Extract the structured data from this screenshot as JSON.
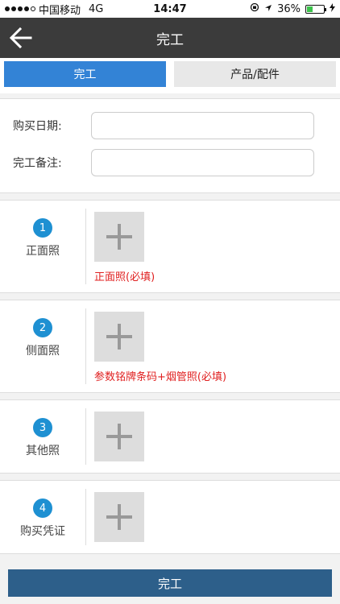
{
  "statusbar": {
    "carrier": "中国移动",
    "network": "4G",
    "time": "14:47",
    "battery_text": "36%",
    "battery_level": 0.36,
    "battery_color": "#3cc34b"
  },
  "navbar": {
    "title": "完工",
    "back_icon": "arrow-left-icon"
  },
  "tabs": [
    {
      "label": "完工",
      "active": true
    },
    {
      "label": "产品/配件",
      "active": false
    }
  ],
  "form": {
    "purchase_date_label": "购买日期:",
    "purchase_date_value": "",
    "note_label": "完工备注:",
    "note_value": ""
  },
  "photos": [
    {
      "number": "1",
      "name": "正面照",
      "hint": "正面照(必填)"
    },
    {
      "number": "2",
      "name": "侧面照",
      "hint": "参数铭牌条码+烟管照(必填)"
    },
    {
      "number": "3",
      "name": "其他照",
      "hint": ""
    },
    {
      "number": "4",
      "name": "购买凭证",
      "hint": ""
    }
  ],
  "footer": {
    "submit_label": "完工"
  },
  "colors": {
    "accent": "#3383d6",
    "navbar": "#3b3b3b",
    "badge": "#1e90d2",
    "hint": "#e02020",
    "submit": "#2d5f8a"
  }
}
